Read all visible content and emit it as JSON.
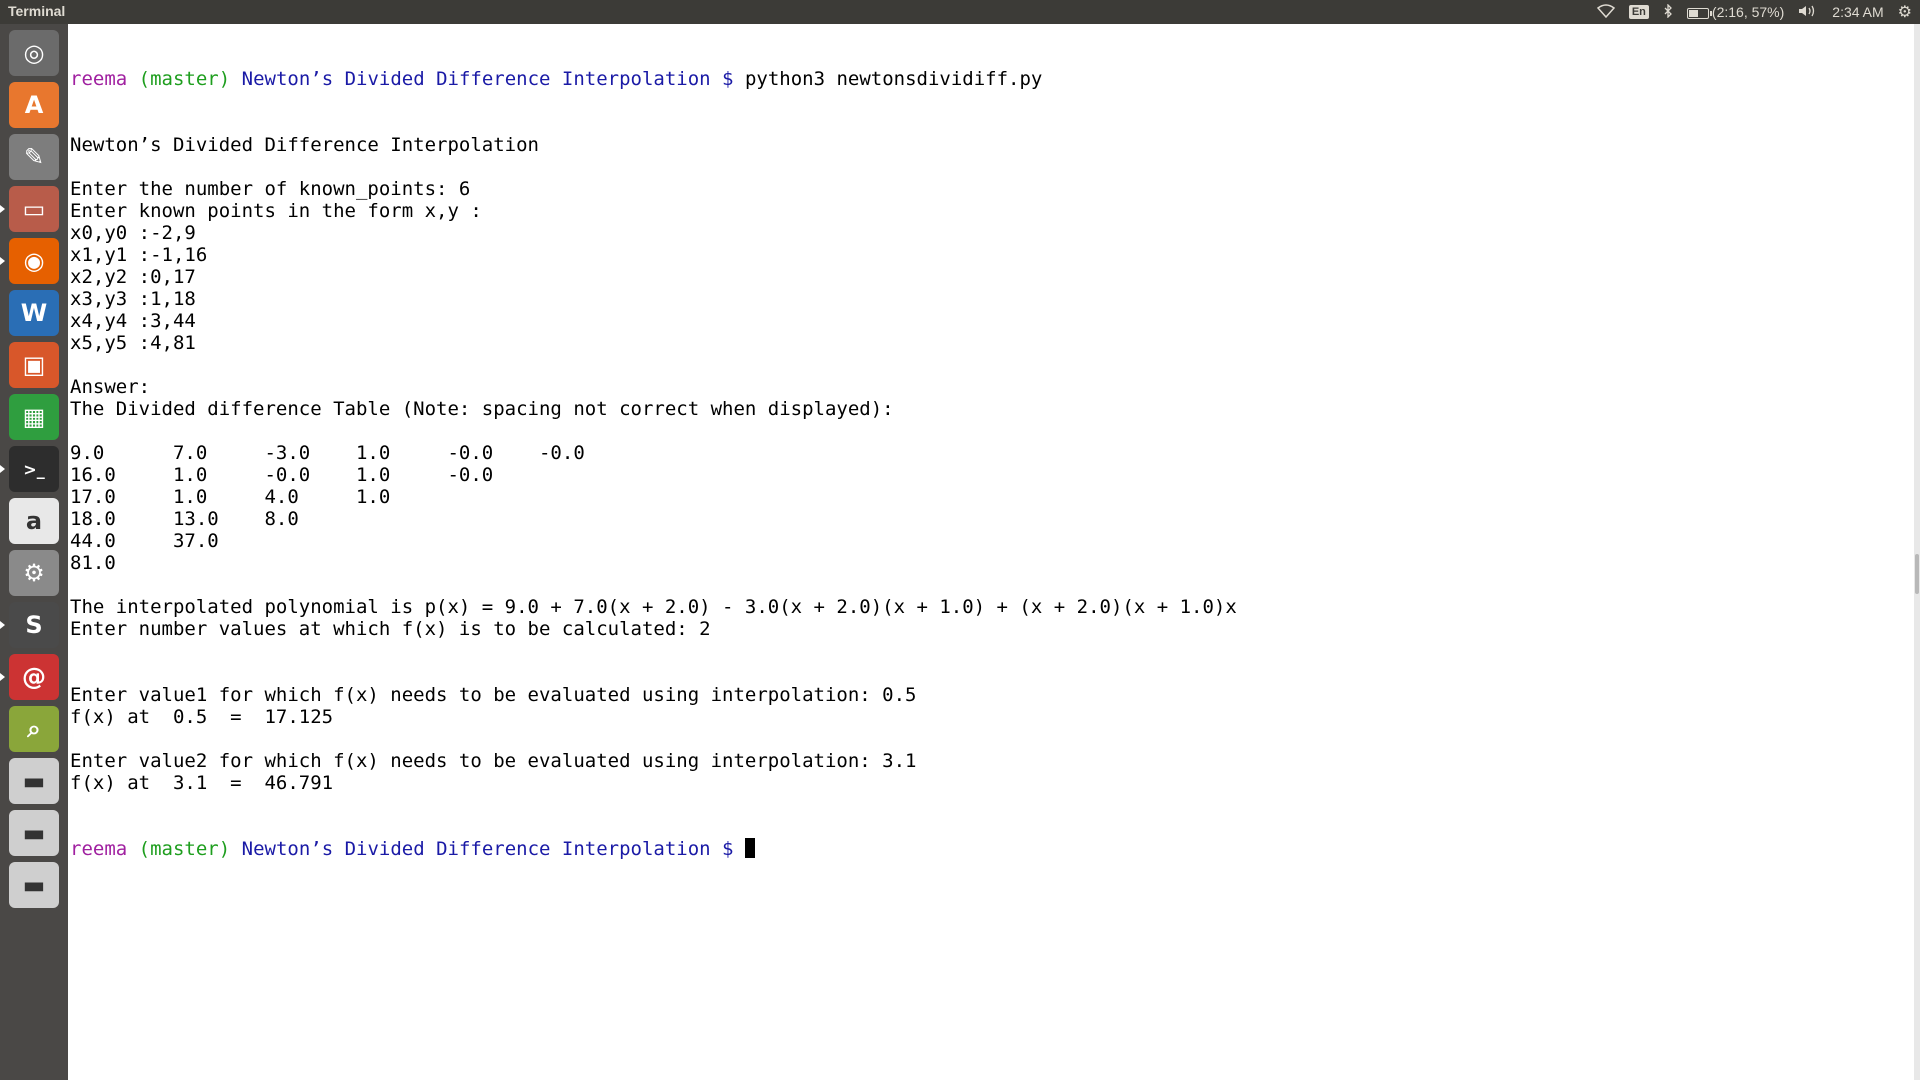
{
  "panel": {
    "app_title": "Terminal",
    "keyboard_layout": "En",
    "battery_text": "(2:16, 57%)",
    "battery_level": 0.57,
    "clock": "2:34 AM",
    "icons": [
      "wifi-icon",
      "bluetooth-icon",
      "battery-icon",
      "volume-icon",
      "gear-icon"
    ]
  },
  "launcher": {
    "items": [
      {
        "name": "dash-home",
        "icon": "ubuntu-logo-icon",
        "color": "#6b6b6b",
        "glyph": "◎",
        "running": false
      },
      {
        "name": "software-center",
        "icon": "shopping-bag-icon",
        "color": "#e8772e",
        "glyph": "A",
        "running": false
      },
      {
        "name": "text-editor",
        "icon": "text-editor-icon",
        "color": "#7d7d7d",
        "glyph": "✎",
        "running": false
      },
      {
        "name": "files",
        "icon": "file-cabinet-icon",
        "color": "#b85c4a",
        "glyph": "▭",
        "running": true
      },
      {
        "name": "firefox",
        "icon": "firefox-icon",
        "color": "#e66000",
        "glyph": "◉",
        "running": true
      },
      {
        "name": "libreoffice-writer",
        "icon": "writer-icon",
        "color": "#2a6eb5",
        "glyph": "W",
        "running": false
      },
      {
        "name": "libreoffice-impress",
        "icon": "impress-icon",
        "color": "#d8572a",
        "glyph": "▣",
        "running": false
      },
      {
        "name": "libreoffice-calc",
        "icon": "calc-icon",
        "color": "#2f9e3f",
        "glyph": "▦",
        "running": false
      },
      {
        "name": "terminal",
        "icon": "terminal-icon",
        "color": "#2d2d2d",
        "glyph": ">_",
        "running": true
      },
      {
        "name": "amazon",
        "icon": "amazon-icon",
        "color": "#e8e8e8",
        "glyph": "a",
        "running": false
      },
      {
        "name": "system-settings",
        "icon": "settings-wrench-icon",
        "color": "#8a8a8a",
        "glyph": "⚙",
        "running": false
      },
      {
        "name": "sublime-text",
        "icon": "sublime-text-icon",
        "color": "#4a4a4a",
        "glyph": "S",
        "running": true
      },
      {
        "name": "email-client",
        "icon": "email-icon",
        "color": "#cc3333",
        "glyph": "@",
        "running": true
      },
      {
        "name": "image-viewer",
        "icon": "image-magnifier-icon",
        "color": "#8aa63a",
        "glyph": "⌕",
        "running": false
      },
      {
        "name": "drive-1",
        "icon": "drive-icon",
        "color": "#cfcfcf",
        "glyph": "▬",
        "running": false
      },
      {
        "name": "drive-2",
        "icon": "drive-icon",
        "color": "#cfcfcf",
        "glyph": "▬",
        "running": false
      },
      {
        "name": "drive-3",
        "icon": "drive-icon",
        "color": "#cfcfcf",
        "glyph": "▬",
        "running": false
      }
    ]
  },
  "terminal": {
    "prompt": {
      "user": "reema",
      "branch": "(master)",
      "path": "Newton’s Divided Difference Interpolation $",
      "colors": {
        "user": "#a020a0",
        "branch": "#1e9e1e",
        "path": "#1a1aa6"
      }
    },
    "command": " python3 newtonsdividiff.py",
    "output": [
      "Newton’s Divided Difference Interpolation",
      "",
      "Enter the number of known_points: 6",
      "Enter known points in the form x,y :",
      "x0,y0 :-2,9",
      "x1,y1 :-1,16",
      "x2,y2 :0,17",
      "x3,y3 :1,18",
      "x4,y4 :3,44",
      "x5,y5 :4,81",
      "",
      "Answer:",
      "The Divided difference Table (Note: spacing not correct when displayed):",
      "",
      "9.0      7.0     -3.0    1.0     -0.0    -0.0",
      "16.0     1.0     -0.0    1.0     -0.0",
      "17.0     1.0     4.0     1.0",
      "18.0     13.0    8.0",
      "44.0     37.0",
      "81.0",
      "",
      "The interpolated polynomial is p(x) = 9.0 + 7.0(x + 2.0) - 3.0(x + 2.0)(x + 1.0) + (x + 2.0)(x + 1.0)x",
      "Enter number values at which f(x) is to be calculated: 2",
      "",
      "",
      "Enter value1 for which f(x) needs to be evaluated using interpolation: 0.5",
      "f(x) at  0.5  =  17.125",
      "",
      "Enter value2 for which f(x) needs to be evaluated using interpolation: 3.1",
      "f(x) at  3.1  =  46.791"
    ]
  }
}
